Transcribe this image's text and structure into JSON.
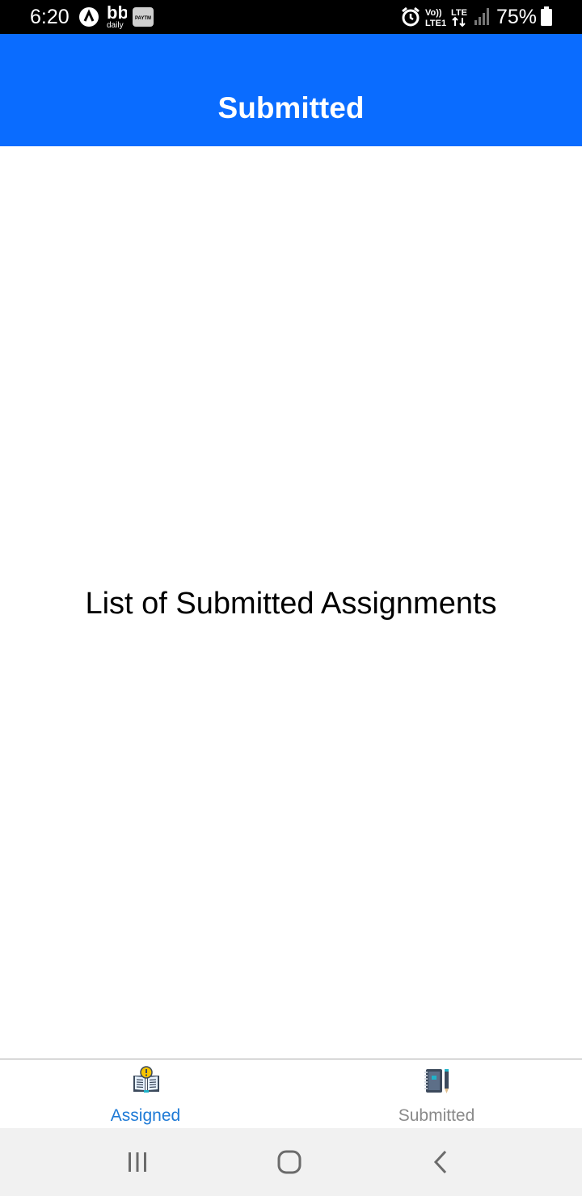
{
  "status_bar": {
    "time": "6:20",
    "notification_icons": [
      "nav-arrow-icon",
      "bb-daily-icon",
      "paytm-icon"
    ],
    "bb_label": "daily",
    "paytm_label": "PAYTM",
    "system_icons": [
      "alarm-icon",
      "volte-icon",
      "lte-icon",
      "signal-icon",
      "battery-icon"
    ],
    "volte_label": "Vo))",
    "volte_sub": "LTE1",
    "lte_label": "LTE",
    "battery": "75%"
  },
  "header": {
    "title": "Submitted",
    "color": "#0a6cff"
  },
  "main": {
    "message": "List of Submitted Assignments"
  },
  "tabs": [
    {
      "label": "Assigned",
      "icon": "open-book-icon",
      "active": true,
      "color": "#1e7ad6"
    },
    {
      "label": "Submitted",
      "icon": "notebook-pencil-icon",
      "active": false,
      "color": "#8a8a8a"
    }
  ],
  "nav_bar": {
    "buttons": [
      "recent-apps-icon",
      "home-icon",
      "back-icon"
    ]
  }
}
